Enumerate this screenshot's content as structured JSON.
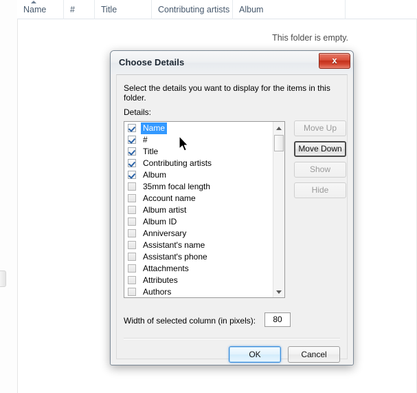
{
  "explorer": {
    "columns": [
      {
        "label": "Name",
        "sort": "ascending"
      },
      {
        "label": "#",
        "sort": "none"
      },
      {
        "label": "Title",
        "sort": "none"
      },
      {
        "label": "Contributing artists",
        "sort": "none"
      },
      {
        "label": "Album",
        "sort": "none"
      }
    ],
    "empty_message": "This folder is empty."
  },
  "dialog": {
    "title": "Choose Details",
    "close_label": "x",
    "instruction": "Select the details you want to display for the items in this folder.",
    "details_label": "Details:",
    "details_items": [
      {
        "label": "Name",
        "checked": true,
        "selected": true
      },
      {
        "label": "#",
        "checked": true,
        "selected": false
      },
      {
        "label": "Title",
        "checked": true,
        "selected": false
      },
      {
        "label": "Contributing artists",
        "checked": true,
        "selected": false
      },
      {
        "label": "Album",
        "checked": true,
        "selected": false
      },
      {
        "label": "35mm focal length",
        "checked": false,
        "selected": false
      },
      {
        "label": "Account name",
        "checked": false,
        "selected": false
      },
      {
        "label": "Album artist",
        "checked": false,
        "selected": false
      },
      {
        "label": "Album ID",
        "checked": false,
        "selected": false
      },
      {
        "label": "Anniversary",
        "checked": false,
        "selected": false
      },
      {
        "label": "Assistant's name",
        "checked": false,
        "selected": false
      },
      {
        "label": "Assistant's phone",
        "checked": false,
        "selected": false
      },
      {
        "label": "Attachments",
        "checked": false,
        "selected": false
      },
      {
        "label": "Attributes",
        "checked": false,
        "selected": false
      },
      {
        "label": "Authors",
        "checked": false,
        "selected": false
      }
    ],
    "side_buttons": [
      {
        "label": "Move Up",
        "state": "disabled"
      },
      {
        "label": "Move Down",
        "state": "focused"
      },
      {
        "label": "Show",
        "state": "disabled"
      },
      {
        "label": "Hide",
        "state": "disabled"
      }
    ],
    "width_label": "Width of selected column (in pixels):",
    "width_value": "80",
    "ok_label": "OK",
    "cancel_label": "Cancel"
  },
  "colors": {
    "selection_blue": "#3399ff",
    "close_red": "#c4301c",
    "default_button_blue": "#3c8ddb",
    "header_text": "#46586c"
  }
}
